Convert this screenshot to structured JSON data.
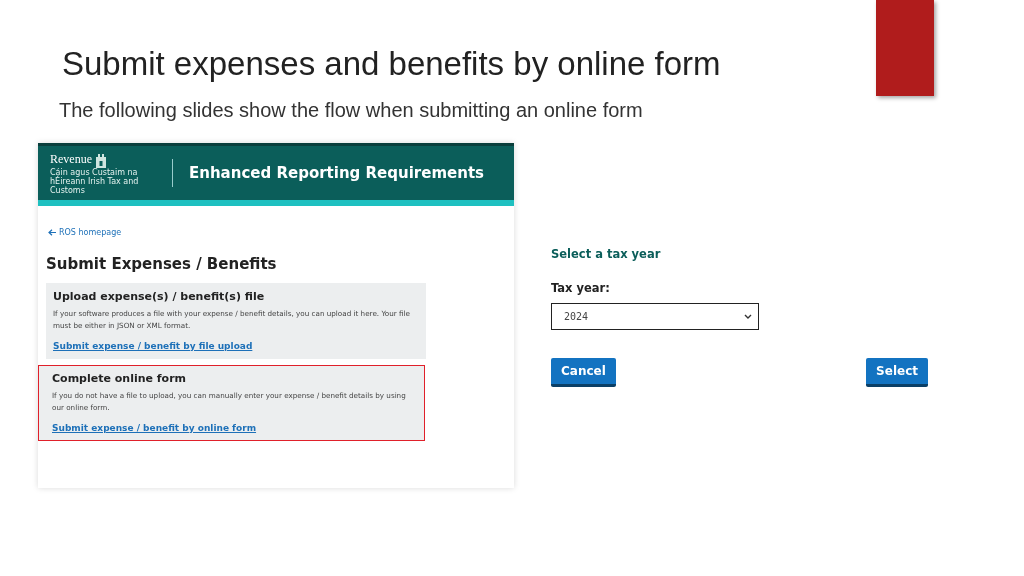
{
  "slide": {
    "title": "Submit expenses and benefits by online form",
    "subtitle": "The following slides show the flow when submitting an online form"
  },
  "portal": {
    "logo": "Revenue",
    "logo_subtext": "Cáin agus Custaim na hÉireann Irish Tax and Customs",
    "header_title": "Enhanced Reporting Requirements",
    "back_link": "ROS homepage",
    "page_title": "Submit Expenses / Benefits",
    "sections": [
      {
        "heading": "Upload expense(s) / benefit(s) file",
        "text": "If your software produces a file with your expense / benefit details, you can upload it here. Your file must be either in JSON or XML format.",
        "link": "Submit expense / benefit by file upload",
        "highlighted": false
      },
      {
        "heading": "Complete online form",
        "text": "If you do not have a file to upload, you can manually enter your expense / benefit details by using our online form.",
        "link": "Submit expense / benefit by online form",
        "highlighted": true
      }
    ]
  },
  "tax_year_form": {
    "heading": "Select a tax year",
    "label": "Tax year:",
    "value": "2024",
    "buttons": [
      "Cancel",
      "Select"
    ]
  }
}
